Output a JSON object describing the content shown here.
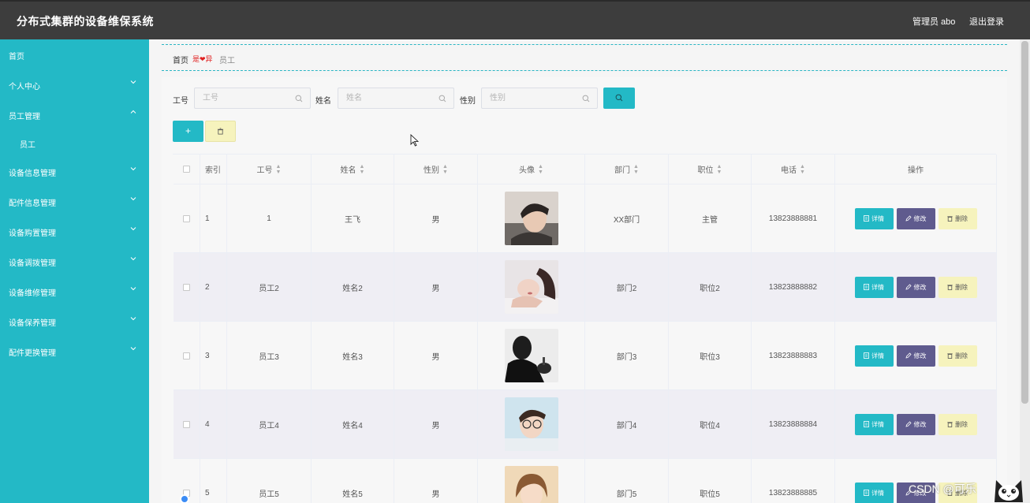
{
  "header": {
    "title": "分布式集群的设备维保系统",
    "user": "管理员 abo",
    "logout": "退出登录"
  },
  "sidebar": {
    "items": [
      {
        "label": "首页",
        "chevron": "none"
      },
      {
        "label": "个人中心",
        "chevron": "down"
      },
      {
        "label": "员工管理",
        "chevron": "up"
      },
      {
        "label": "员工",
        "chevron": "none",
        "sub": true
      },
      {
        "label": "设备信息管理",
        "chevron": "down"
      },
      {
        "label": "配件信息管理",
        "chevron": "down"
      },
      {
        "label": "设备购置管理",
        "chevron": "down"
      },
      {
        "label": "设备调拨管理",
        "chevron": "down"
      },
      {
        "label": "设备维修管理",
        "chevron": "down"
      },
      {
        "label": "设备保养管理",
        "chevron": "down"
      },
      {
        "label": "配件更换管理",
        "chevron": "down"
      }
    ]
  },
  "breadcrumb": {
    "home": "首页",
    "separator": "是❤异",
    "current": "员工"
  },
  "filters": {
    "gonghao_label": "工号",
    "gonghao_placeholder": "工号",
    "name_label": "姓名",
    "name_placeholder": "姓名",
    "gender_label": "性别",
    "gender_placeholder": "性别"
  },
  "toolbar": {
    "add_label": "+"
  },
  "table": {
    "columns": [
      "索引",
      "工号",
      "姓名",
      "性别",
      "头像",
      "部门",
      "职位",
      "电话",
      "操作"
    ],
    "rows": [
      {
        "index": "1",
        "gonghao": "1",
        "name": "王飞",
        "gender": "男",
        "dept": "XX部门",
        "position": "主管",
        "phone": "13823888881"
      },
      {
        "index": "2",
        "gonghao": "员工2",
        "name": "姓名2",
        "gender": "男",
        "dept": "部门2",
        "position": "职位2",
        "phone": "13823888882"
      },
      {
        "index": "3",
        "gonghao": "员工3",
        "name": "姓名3",
        "gender": "男",
        "dept": "部门3",
        "position": "职位3",
        "phone": "13823888883"
      },
      {
        "index": "4",
        "gonghao": "员工4",
        "name": "姓名4",
        "gender": "男",
        "dept": "部门4",
        "position": "职位4",
        "phone": "13823888884"
      },
      {
        "index": "5",
        "gonghao": "员工5",
        "name": "姓名5",
        "gender": "男",
        "dept": "部门5",
        "position": "职位5",
        "phone": "13823888885"
      }
    ],
    "actions": {
      "detail": "详情",
      "edit": "修改",
      "delete": "删除"
    }
  },
  "watermark": "CSDN @可乐",
  "colors": {
    "topbar": "#3d3d3d",
    "sidebar": "#23b9c6",
    "accent": "#23b9c6",
    "edit_button": "#5f5b8e",
    "delete_button": "#f6f3bd"
  }
}
